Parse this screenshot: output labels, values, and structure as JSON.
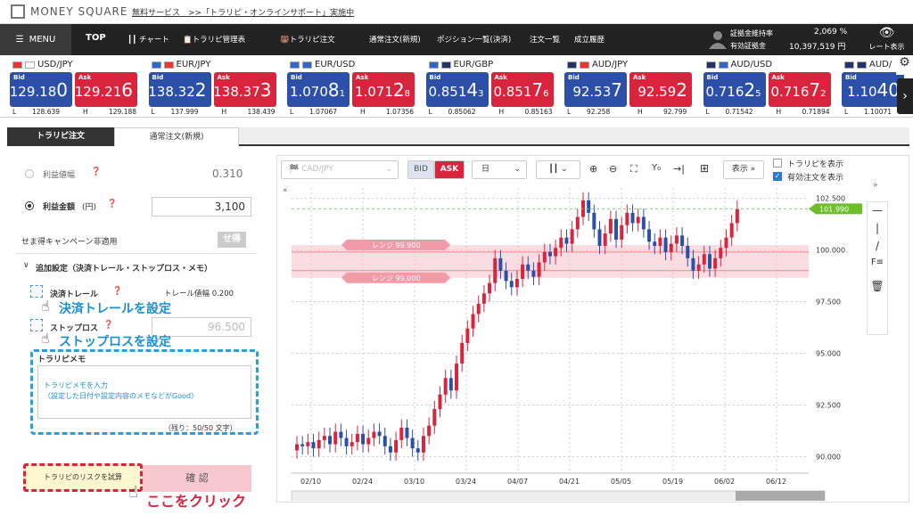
{
  "header": {
    "brand": "MONEY SQUARE",
    "announcement": "無料サービス　>>「トラリピ・オンラインサポート」実施中"
  },
  "nav": {
    "menu": "MENU",
    "items": [
      "TOP",
      "チャート",
      "トラリピ管理表",
      "トラリピ注文",
      "通常注文(新規)",
      "ポジション一覧(決済)",
      "注文一覧",
      "成立履歴"
    ],
    "margin_rate_label": "証拠金維持率",
    "margin_rate_value": "2,069 %",
    "effective_margin_label": "有効証拠金",
    "effective_margin_value": "10,397,519 円",
    "rate_display": "レート表示"
  },
  "rates": [
    {
      "pair": "USD/JPY",
      "bid_main": "129.18",
      "bid_big": "0",
      "bid_small": "",
      "ask_main": "129.21",
      "ask_big": "6",
      "ask_small": "",
      "low": "128.639",
      "high": "129.188"
    },
    {
      "pair": "EUR/JPY",
      "bid_main": "138.32",
      "bid_big": "2",
      "bid_small": "",
      "ask_main": "138.37",
      "ask_big": "3",
      "ask_small": "",
      "low": "137.999",
      "high": "138.439"
    },
    {
      "pair": "EUR/USD",
      "bid_main": "1.070",
      "bid_big": "8",
      "bid_small": "1",
      "ask_main": "1.071",
      "ask_big": "2",
      "ask_small": "8",
      "low": "1.07067",
      "high": "1.07356"
    },
    {
      "pair": "EUR/GBP",
      "bid_main": "0.851",
      "bid_big": "4",
      "bid_small": "3",
      "ask_main": "0.851",
      "ask_big": "7",
      "ask_small": "6",
      "low": "0.85062",
      "high": "0.85163"
    },
    {
      "pair": "AUD/JPY",
      "bid_main": "92.53",
      "bid_big": "7",
      "bid_small": "",
      "ask_main": "92.59",
      "ask_big": "2",
      "ask_small": "",
      "low": "92.258",
      "high": "92.799"
    },
    {
      "pair": "AUD/USD",
      "bid_main": "0.716",
      "bid_big": "2",
      "bid_small": "5",
      "ask_main": "0.716",
      "ask_big": "7",
      "ask_small": "2",
      "low": "0.71542",
      "high": "0.71894"
    },
    {
      "pair": "AUD/",
      "bid_main": "1.10",
      "bid_big": "40",
      "bid_small": "",
      "ask_main": "",
      "ask_big": "",
      "ask_small": "",
      "low": "1.10071",
      "high": ""
    }
  ],
  "labels": {
    "bid": "Bid",
    "ask": "Ask",
    "low": "L",
    "high": "H"
  },
  "tabs": [
    "トラリピ注文",
    "通常注文(新規)"
  ],
  "form": {
    "profit_width_label": "利益値幅",
    "profit_width_value": "0.310",
    "profit_amount_label": "利益金額",
    "profit_amount_unit": "(円)",
    "profit_amount_value": "3,100",
    "campaign": "せま得キャンペーン非適用",
    "campaign_badge": "せ得",
    "additional_settings": "追加設定（決済トレール・ストップロス・メモ）",
    "trail_label": "決済トレール",
    "trail_width": "トレール値幅 0.200",
    "stop_label": "ストップロス",
    "stop_value": "96.500",
    "memo_label": "トラリピメモ",
    "memo_text_1": "トラリピメモを入力",
    "memo_text_2": "（設定した日付や設定内容のメモなどがGood）",
    "memo_count": "（残り：50/50 文字）",
    "risk_button": "トラリピのリスクを試算",
    "confirm_button": "確 認"
  },
  "annotations": {
    "trail": "決済トレールを設定",
    "stop": "ストップロスを設定",
    "click": "ここをクリック"
  },
  "chart_toolbar": {
    "pair": "CAD/JPY",
    "bid": "BID",
    "ask": "ASK",
    "timeframe": "日",
    "display": "表示",
    "show_trarepi": "トラリピを表示",
    "show_orders": "有効注文を表示"
  },
  "colors": {
    "bid": "#2c4fa8",
    "ask": "#d8243c",
    "up": "#d8243c",
    "down": "#2c4fa8",
    "price_tag": "#6cbf2a"
  },
  "chart_data": {
    "type": "candlestick",
    "x_ticks": [
      "02/10",
      "02/24",
      "03/10",
      "03/24",
      "04/07",
      "04/21",
      "05/05",
      "05/19",
      "06/02",
      "06/12"
    ],
    "y_ticks": [
      90.0,
      92.5,
      95.0,
      97.5,
      100.0,
      102.5
    ],
    "ylim": [
      89.2,
      103.0
    ],
    "current_price": "101.990",
    "range_upper_label": "レンジ 99.900",
    "range_lower_label": "レンジ 99.000",
    "range_upper": 99.9,
    "range_lower": 99.0,
    "closes": [
      90.6,
      90.5,
      90.7,
      90.4,
      90.8,
      91.0,
      90.6,
      91.2,
      90.9,
      90.5,
      90.7,
      91.1,
      90.6,
      90.9,
      91.2,
      91.0,
      90.5,
      90.2,
      90.8,
      91.4,
      90.9,
      90.4,
      90.2,
      91.0,
      91.5,
      92.3,
      93.0,
      93.8,
      93.2,
      94.5,
      95.5,
      96.2,
      96.9,
      97.4,
      97.9,
      98.4,
      99.6,
      99.0,
      98.5,
      98.2,
      98.6,
      99.3,
      99.0,
      98.7,
      99.4,
      99.9,
      99.7,
      100.1,
      100.6,
      100.3,
      101.0,
      101.6,
      102.4,
      101.8,
      101.0,
      100.2,
      100.8,
      101.5,
      100.5,
      101.2,
      101.8,
      101.3,
      101.6,
      101.0,
      100.4,
      100.2,
      100.6,
      99.9,
      100.3,
      100.7,
      100.2,
      99.6,
      99.0,
      99.3,
      99.8,
      99.1,
      99.6,
      100.1,
      100.6,
      101.3,
      102.0
    ]
  }
}
